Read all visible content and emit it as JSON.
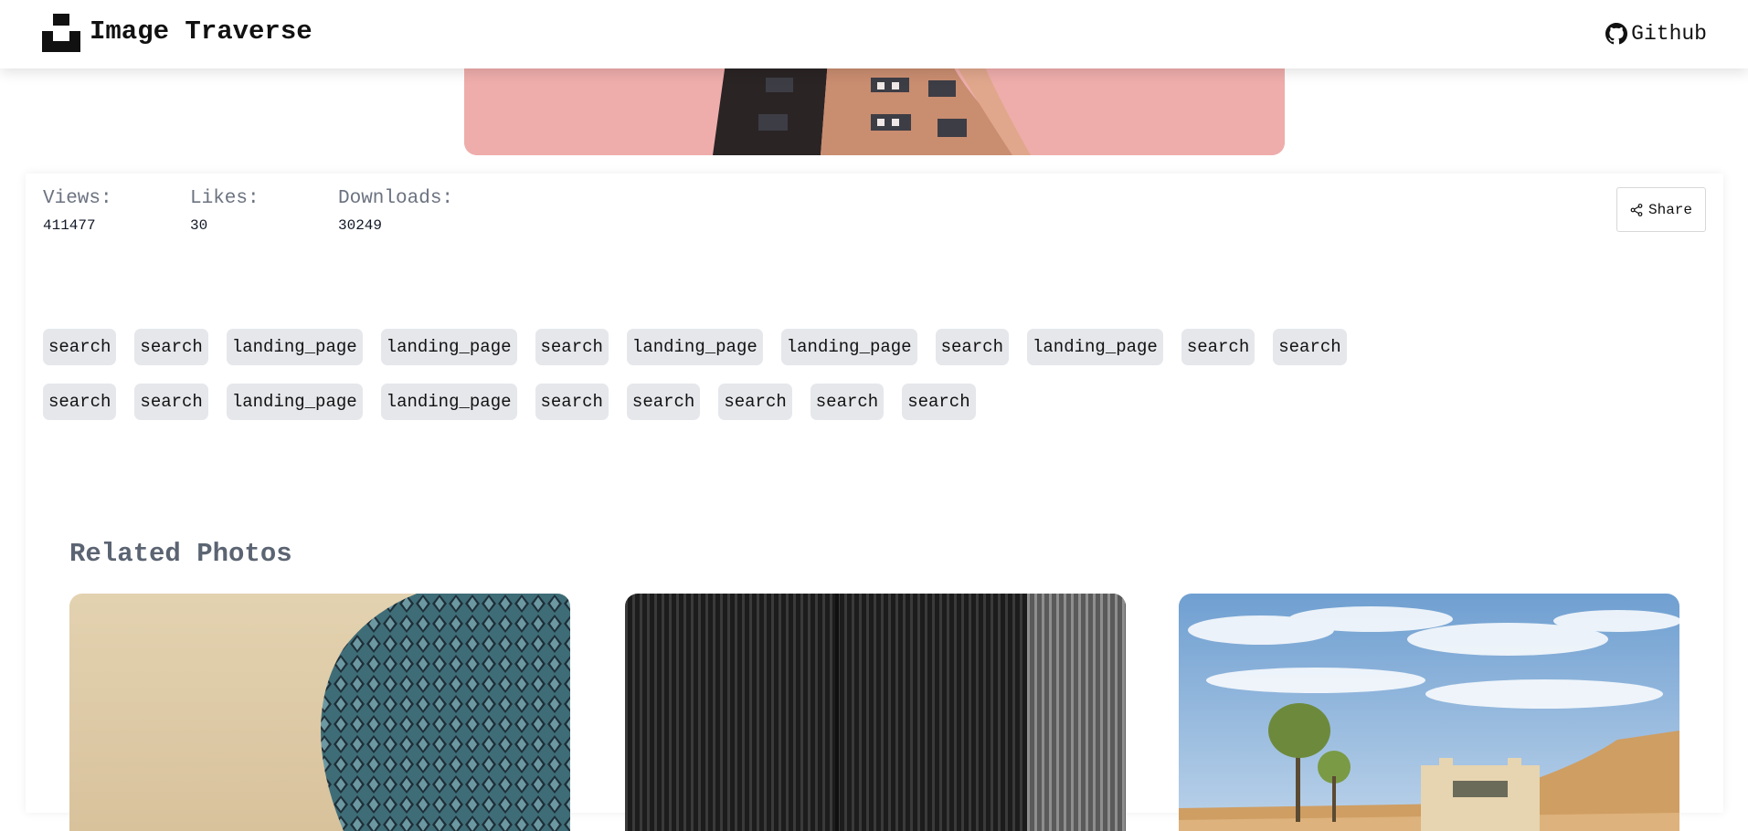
{
  "header": {
    "brand": "Image Traverse",
    "github_label": "Github"
  },
  "stats": [
    {
      "label": "Views:",
      "value": "411477"
    },
    {
      "label": "Likes:",
      "value": "30"
    },
    {
      "label": "Downloads:",
      "value": "30249"
    }
  ],
  "share_label": "Share",
  "tags": [
    "search",
    "search",
    "landing_page",
    "landing_page",
    "search",
    "landing_page",
    "landing_page",
    "search",
    "landing_page",
    "search",
    "search",
    "search",
    "search",
    "landing_page",
    "landing_page",
    "search",
    "search",
    "search",
    "search",
    "search"
  ],
  "related": {
    "title": "Related Photos"
  },
  "colors": {
    "hero_background": "#eeadab",
    "tag_background": "#e5e7eb",
    "muted_text": "#6b7280"
  },
  "icons": {
    "logo": "unsplash-logo-icon",
    "github": "github-icon",
    "share": "share-icon"
  }
}
